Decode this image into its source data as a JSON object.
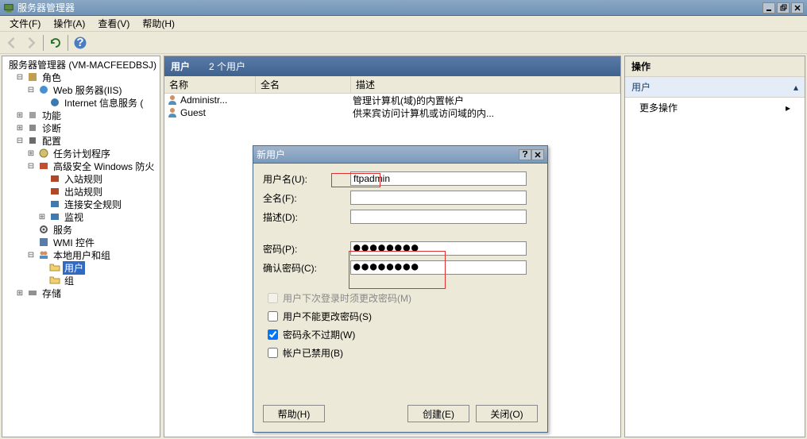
{
  "window": {
    "title": "服务器管理器",
    "min_tooltip": "最小化",
    "max_tooltip": "还原",
    "close_tooltip": "关闭"
  },
  "menubar": {
    "file": "文件(F)",
    "action": "操作(A)",
    "view": "查看(V)",
    "help": "帮助(H)"
  },
  "tree": {
    "root": "服务器管理器 (VM-MACFEEDBSJ)",
    "roles": "角色",
    "web_server": "Web 服务器(IIS)",
    "iis": "Internet 信息服务 (",
    "function": "功能",
    "diagnose": "诊断",
    "config": "配置",
    "scheduler": "任务计划程序",
    "firewall": "高级安全 Windows 防火",
    "inbound": "入站规则",
    "outbound": "出站规则",
    "conn_sec": "连接安全规则",
    "monitor": "监视",
    "service": "服务",
    "wmi": "WMI 控件",
    "local_users": "本地用户和组",
    "users": "用户",
    "groups": "组",
    "storage": "存储"
  },
  "center": {
    "title": "用户",
    "count": "2 个用户",
    "col_name": "名称",
    "col_full": "全名",
    "col_desc": "描述",
    "rows": [
      {
        "name": "Administr...",
        "full": "",
        "desc": "管理计算机(域)的内置帐户"
      },
      {
        "name": "Guest",
        "full": "",
        "desc": "供来宾访问计算机或访问域的内..."
      }
    ]
  },
  "actions": {
    "title": "操作",
    "subtitle": "用户",
    "more": "更多操作"
  },
  "dialog": {
    "title": "新用户",
    "username_label": "用户名(U):",
    "username_value": "ftpadmin",
    "fullname_label": "全名(F):",
    "fullname_value": "",
    "desc_label": "描述(D):",
    "desc_value": "",
    "password_label": "密码(P):",
    "password_value": "●●●●●●●●",
    "confirm_label": "确认密码(C):",
    "confirm_value": "●●●●●●●●",
    "chk_must_change": "用户下次登录时须更改密码(M)",
    "chk_cannot_change": "用户不能更改密码(S)",
    "chk_never_expire": "密码永不过期(W)",
    "chk_disabled": "帐户已禁用(B)",
    "btn_help": "帮助(H)",
    "btn_create": "创建(E)",
    "btn_close": "关闭(O)"
  }
}
